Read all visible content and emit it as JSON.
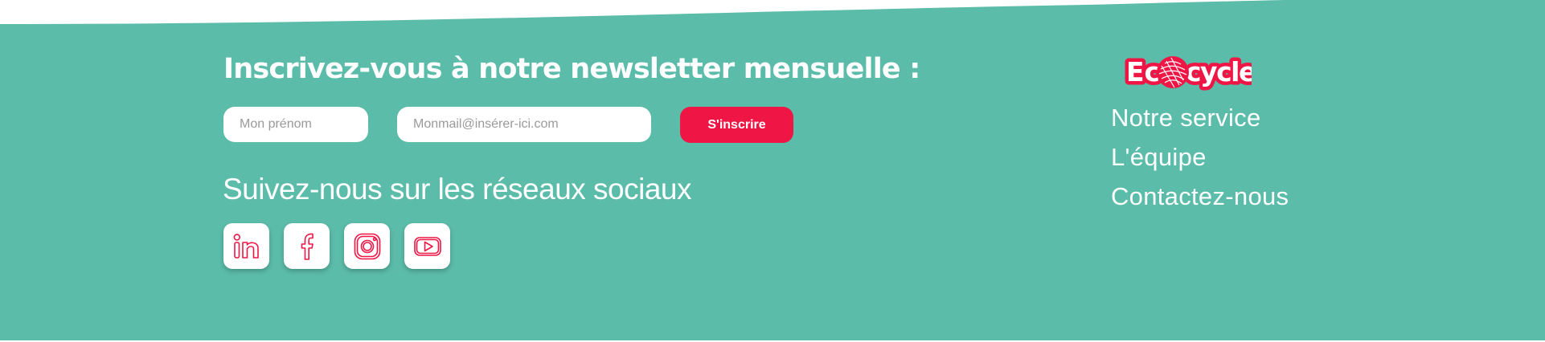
{
  "colors": {
    "background": "#5bbca9",
    "accent": "#ef1646",
    "text": "#ffffff"
  },
  "newsletter": {
    "title": "Inscrivez-vous à notre newsletter mensuelle :",
    "first_name_placeholder": "Mon prénom",
    "email_placeholder": "Monmail@insérer-ici.com",
    "submit_label": "S'inscrire"
  },
  "social": {
    "title": "Suivez-nous sur les réseaux sociaux",
    "icons": [
      "linkedin-icon",
      "facebook-icon",
      "instagram-icon",
      "youtube-icon"
    ]
  },
  "brand": {
    "logo_text": "Ecocycle"
  },
  "nav": {
    "items": [
      "Notre service",
      "L'équipe",
      "Contactez-nous"
    ]
  }
}
